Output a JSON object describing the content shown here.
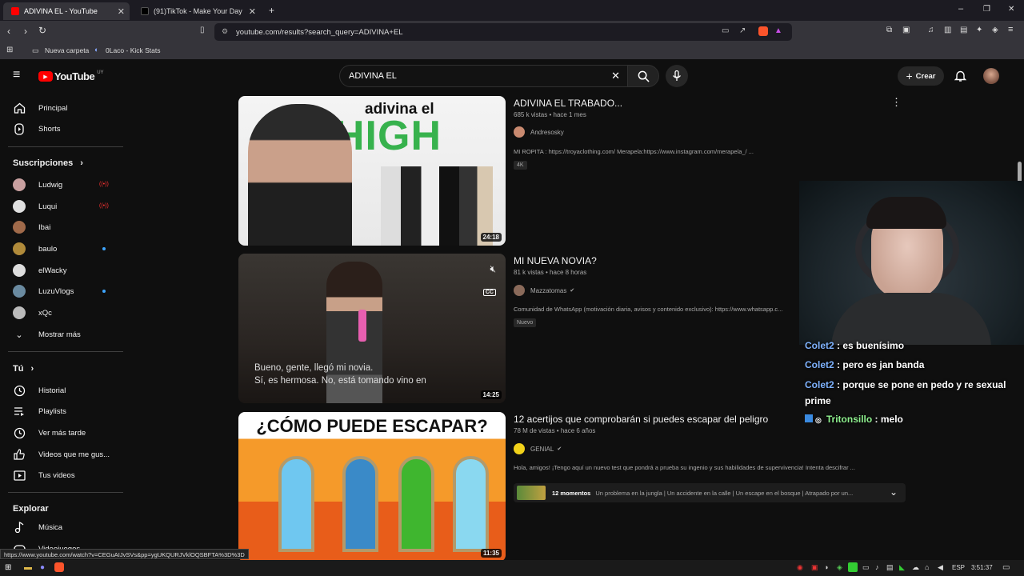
{
  "browser": {
    "tabs": [
      {
        "label": "ADIVINA EL - YouTube",
        "color": "#ff0000"
      },
      {
        "label": "(91)TikTok - Make Your Day",
        "color": "#222222"
      }
    ],
    "url": "youtube.com/results?search_query=ADIVINA+EL",
    "bookmarks": [
      "Nueva carpeta",
      "0Laco - Kick Stats"
    ],
    "status_url": "https://www.youtube.com/watch?v=CEGuAIJvSVs&pp=ygUKQURJVklOQSBFTA%3D%3D"
  },
  "yt": {
    "logo": "YouTube",
    "region": "UY",
    "search_value": "ADIVINA EL",
    "create_label": "Crear",
    "sidebar": {
      "main": [
        {
          "label": "Principal",
          "icon": "home-icon"
        },
        {
          "label": "Shorts",
          "icon": "shorts-icon"
        }
      ],
      "subs_header": "Suscripciones",
      "subs": [
        {
          "label": "Ludwig",
          "status": "live",
          "color": "#c9a0a0"
        },
        {
          "label": "Luqui",
          "status": "live",
          "color": "#e0e0e0"
        },
        {
          "label": "Ibai",
          "status": "",
          "color": "#a06a4a"
        },
        {
          "label": "baulo",
          "status": "new",
          "color": "#b08a3a"
        },
        {
          "label": "elWacky",
          "status": "",
          "color": "#dddddd"
        },
        {
          "label": "LuzuVlogs",
          "status": "new",
          "color": "#6a8aa0"
        },
        {
          "label": "xQc",
          "status": "",
          "color": "#bbbbbb"
        }
      ],
      "more_label": "Mostrar más",
      "you_header": "Tú",
      "you": [
        {
          "label": "Historial",
          "icon": "history-icon"
        },
        {
          "label": "Playlists",
          "icon": "playlists-icon"
        },
        {
          "label": "Ver más tarde",
          "icon": "watch-later-icon"
        },
        {
          "label": "Videos que me gus...",
          "icon": "liked-icon"
        },
        {
          "label": "Tus videos",
          "icon": "your-videos-icon"
        }
      ],
      "explore_header": "Explorar",
      "explore": [
        {
          "label": "Música",
          "icon": "music-icon"
        },
        {
          "label": "Videojuegos",
          "icon": "gaming-icon"
        }
      ]
    },
    "videos": [
      {
        "title": "ADIVINA EL TRABADO...",
        "meta": "685 k vistas • hace 1 mes",
        "channel": "Andresosky",
        "desc": "MI ROPITA : https://troyaclothing.com/ Merapela:https://www.instagram.com/merapela_/ ...",
        "badge": "4K",
        "duration": "24:18",
        "thumb_text_1": "adivina el",
        "thumb_text_2": "HIGH"
      },
      {
        "title": "MI NUEVA NOVIA?",
        "meta": "81 k vistas • hace 8 horas",
        "channel": "Mazzatomas",
        "desc": "Comunidad de WhatsApp (motivación diaria, avisos y contenido exclusivo): https://www.whatsapp.c...",
        "badge": "Nuevo",
        "duration": "14:25",
        "subtitle_1": "Bueno, gente, llegó mi novia.",
        "subtitle_2": "Sí, es hermosa. No, está tomando vino en",
        "cc": "CC"
      },
      {
        "title": "12 acertijos que comprobarán si puedes escapar del peligro",
        "meta": "78 M de vistas • hace 6 años",
        "channel": "GENIAL",
        "desc": "Hola, amigos! ¡Tengo aquí un nuevo test que pondrá a prueba su ingenio y sus habilidades de supervivencia! Intenta descifrar ...",
        "duration": "11:35",
        "thumb_text": "¿CÓMO PUEDE ESCAPAR?",
        "moments_label": "12 momentos",
        "moments_text": "Un problema en la jungla | Un accidente en la calle | Un escape en el bosque | Atrapado por un..."
      }
    ]
  },
  "chat": [
    {
      "user": "Colet2",
      "text": ": es buenísimo"
    },
    {
      "user": "Colet2",
      "text": ": pero es jan banda"
    },
    {
      "user": "Colet2",
      "text": ": porque se pone en pedo y re sexual"
    },
    {
      "user": "",
      "text": "prime"
    },
    {
      "user": "Tritonsillo",
      "text": ": melo"
    }
  ],
  "taskbar": {
    "lang": "ESP",
    "time": "3:51:37"
  }
}
